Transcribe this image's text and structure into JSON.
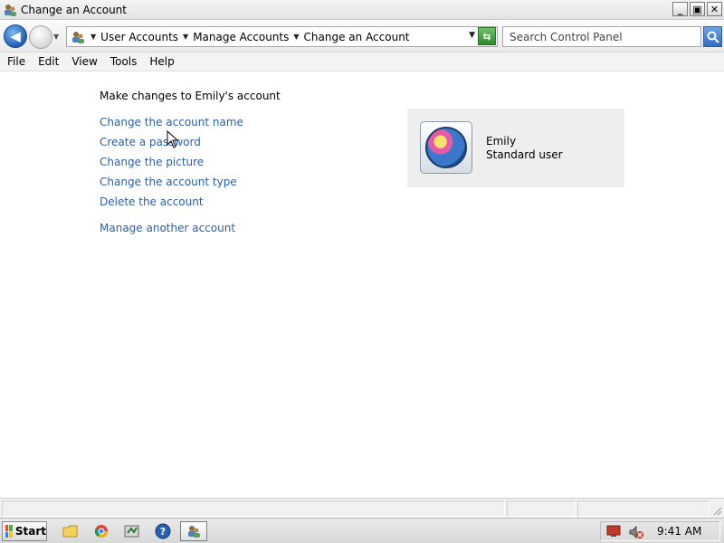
{
  "window": {
    "title": "Change an Account",
    "controls": {
      "minimize": "_",
      "maximize": "▣",
      "close": "✕"
    }
  },
  "navbar": {
    "back_icon": "back-arrow-icon",
    "forward_icon": "forward-arrow-icon",
    "breadcrumbs": [
      "User Accounts",
      "Manage Accounts",
      "Change an Account"
    ],
    "search_placeholder": "Search Control Panel"
  },
  "menu": [
    "File",
    "Edit",
    "View",
    "Tools",
    "Help"
  ],
  "content": {
    "heading": "Make changes to Emily's account",
    "tasks": [
      "Change the account name",
      "Create a password",
      "Change the picture",
      "Change the account type",
      "Delete the account"
    ],
    "other_task": "Manage another account",
    "account": {
      "name": "Emily",
      "type": "Standard user",
      "picture_icon": "user-avatar-icon"
    },
    "link_color": "#2b5ea7"
  },
  "taskbar": {
    "start_label": "Start",
    "quick_launch_icons": [
      "folder-icon",
      "chrome-icon",
      "media-player-icon",
      "help-icon"
    ],
    "active_task_icon": "control-panel-icon",
    "tray_icons": [
      "display-icon",
      "volume-muted-icon"
    ],
    "clock": "9:41 AM"
  }
}
